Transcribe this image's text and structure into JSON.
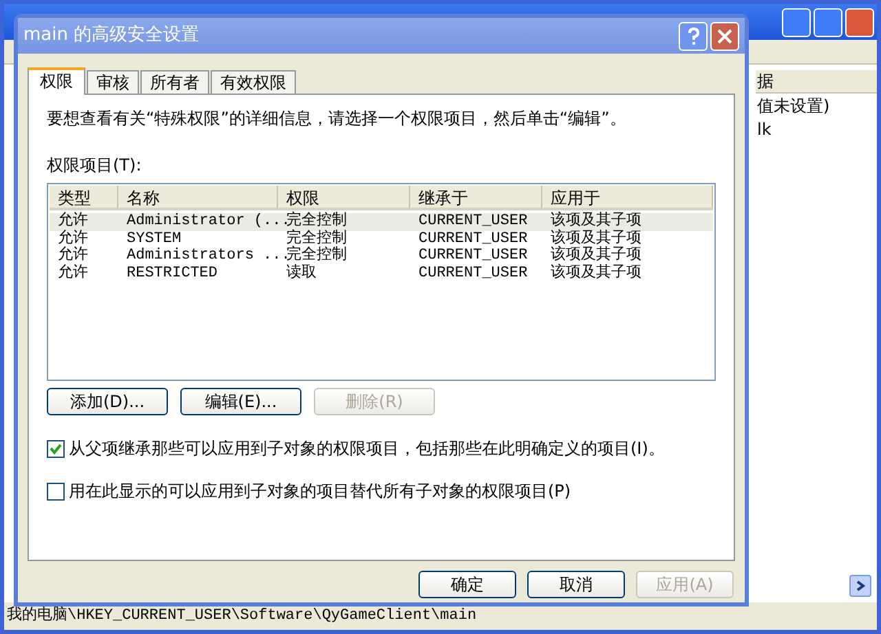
{
  "background_window": {
    "column_header": "据",
    "values": [
      "值未设置)",
      "lk"
    ],
    "status_bar": "我的电脑\\HKEY_CURRENT_USER\\Software\\QyGameClient\\main"
  },
  "dialog": {
    "title": "main 的高级安全设置",
    "tabs": [
      {
        "label": "权限",
        "selected": true
      },
      {
        "label": "审核",
        "selected": false
      },
      {
        "label": "所有者",
        "selected": false
      },
      {
        "label": "有效权限",
        "selected": false
      }
    ],
    "description": "要想查看有关“特殊权限”的详细信息，请选择一个权限项目，然后单击“编辑”。",
    "list_label": "权限项目(T):",
    "columns": [
      "类型",
      "名称",
      "权限",
      "继承于",
      "应用于"
    ],
    "rows": [
      {
        "cells": [
          "允许",
          "Administrator (...",
          "完全控制",
          "CURRENT_USER",
          "该项及其子项"
        ],
        "selected": true
      },
      {
        "cells": [
          "允许",
          "SYSTEM",
          "完全控制",
          "CURRENT_USER",
          "该项及其子项"
        ],
        "selected": false
      },
      {
        "cells": [
          "允许",
          "Administrators ...",
          "完全控制",
          "CURRENT_USER",
          "该项及其子项"
        ],
        "selected": false
      },
      {
        "cells": [
          "允许",
          "RESTRICTED",
          "读取",
          "CURRENT_USER",
          "该项及其子项"
        ],
        "selected": false
      }
    ],
    "list_buttons": [
      {
        "label": "添加(D)...",
        "disabled": false
      },
      {
        "label": "编辑(E)...",
        "disabled": false
      },
      {
        "label": "删除(R)",
        "disabled": true
      }
    ],
    "options": [
      {
        "label": "从父项继承那些可以应用到子对象的权限项目，包括那些在此明确定义的项目(I)。",
        "checked": true
      },
      {
        "label": "用在此显示的可以应用到子对象的项目替代所有子对象的权限项目(P)",
        "checked": false
      }
    ],
    "footer_buttons": [
      {
        "label": "确定",
        "disabled": false
      },
      {
        "label": "取消",
        "disabled": false
      },
      {
        "label": "应用(A)",
        "disabled": true
      }
    ]
  }
}
